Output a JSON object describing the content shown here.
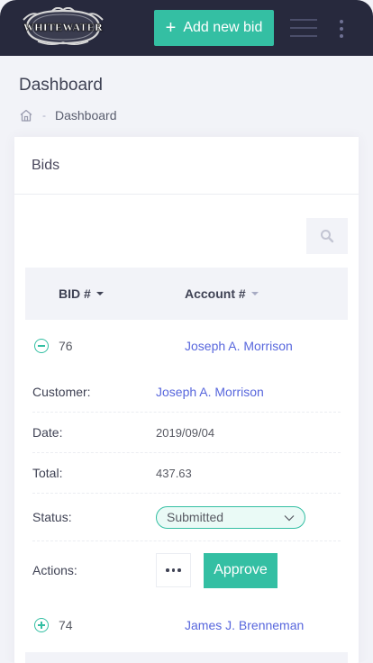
{
  "header": {
    "logo_text": "WHITEWATER",
    "add_bid_label": "Add new bid",
    "add_bid_icon": "plus-icon",
    "menu_icon": "hamburger-icon",
    "more_icon": "vertical-dots-icon"
  },
  "subheader": {
    "title": "Dashboard",
    "breadcrumb": {
      "home_icon": "home-icon",
      "separator": "-",
      "current": "Dashboard"
    }
  },
  "card": {
    "title": "Bids",
    "search_icon": "search-icon",
    "columns": [
      {
        "label": "BID #"
      },
      {
        "label": "Account #"
      }
    ],
    "rows": [
      {
        "bid": "76",
        "account": "Joseph A. Morrison",
        "expanded": true,
        "details": {
          "customer_label": "Customer:",
          "customer": "Joseph A. Morrison",
          "date_label": "Date:",
          "date": "2019/09/04",
          "total_label": "Total:",
          "total": "437.63",
          "status_label": "Status:",
          "status": "Submitted",
          "actions_label": "Actions:",
          "approve_label": "Approve"
        }
      },
      {
        "bid": "74",
        "account": "James J. Brenneman",
        "expanded": false
      }
    ]
  },
  "colors": {
    "topbar": "#27293d",
    "accent": "#34bfa3",
    "link": "#5867dd",
    "background": "#f2f3f8"
  }
}
